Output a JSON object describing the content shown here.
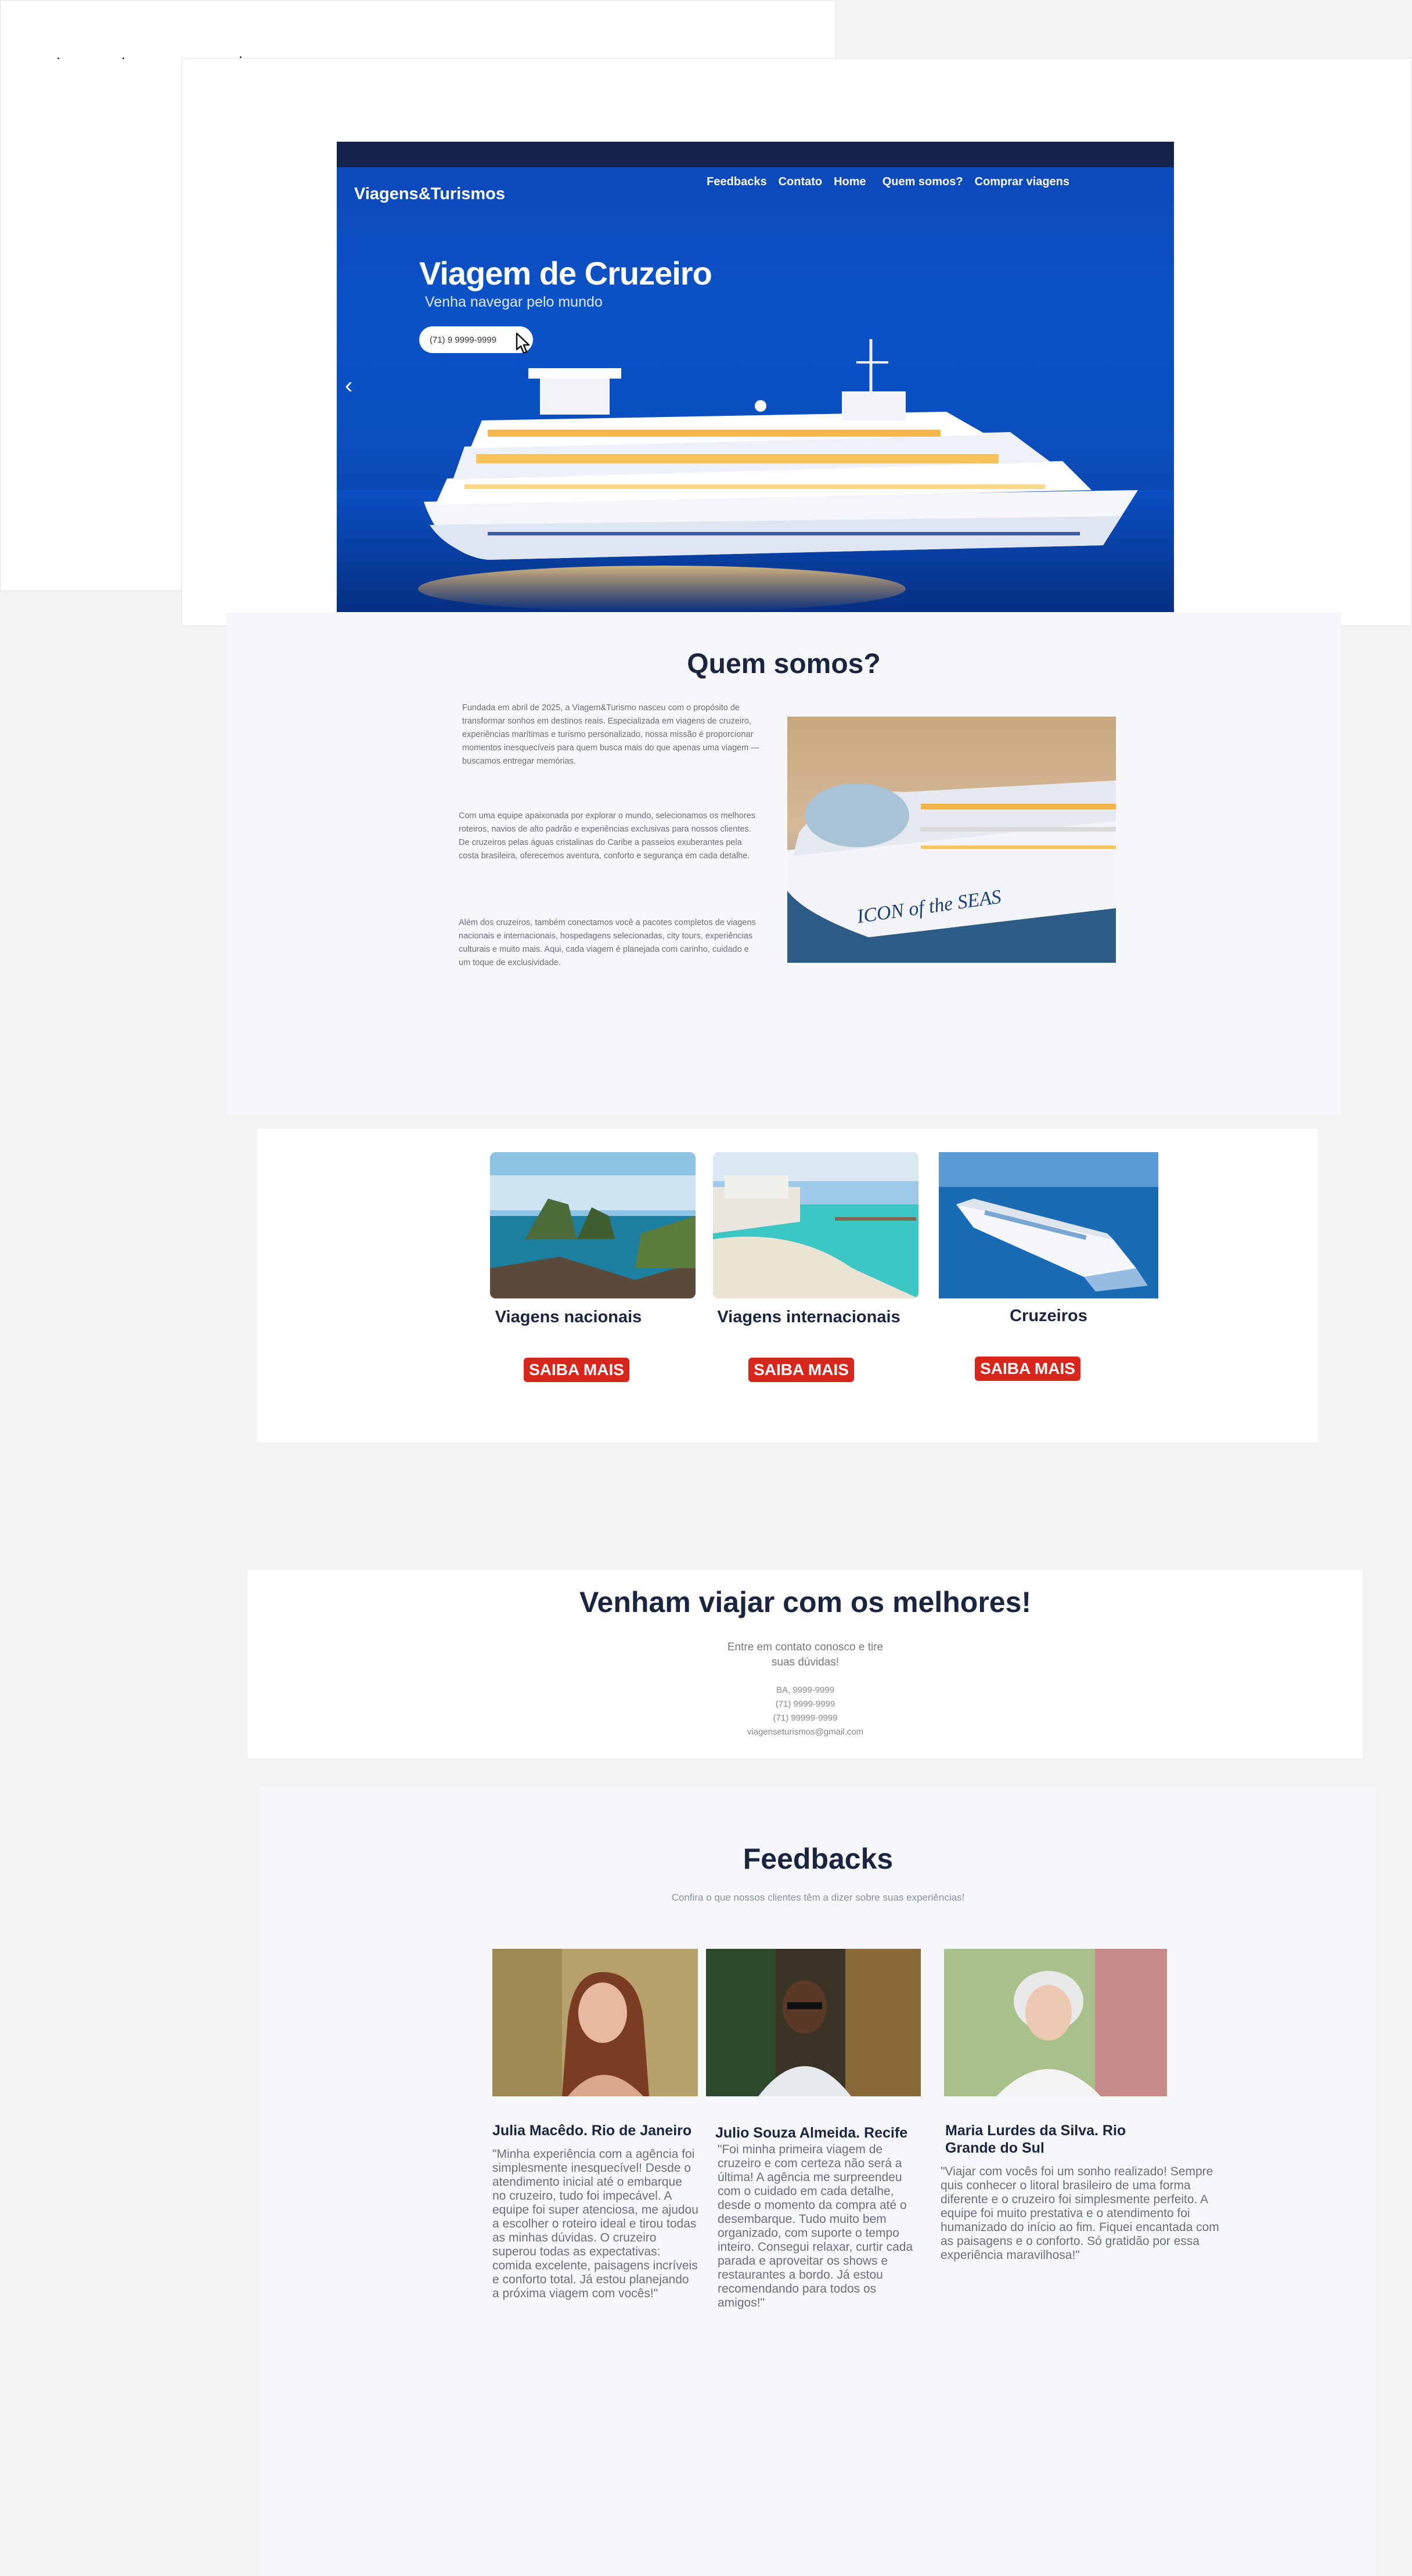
{
  "hero": {
    "brand": "Viagens&Turismos",
    "nav": [
      "Feedbacks",
      "Contato",
      "Home",
      "Quem somos?",
      "Comprar viagens"
    ],
    "title": "Viagem de Cruzeiro",
    "subtitle": "Venha navegar pelo mundo",
    "phone": "(71) 9 9999-9999",
    "prev_arrow": "‹"
  },
  "about": {
    "title": "Quem somos?",
    "paragraphs": [
      "Fundada em abril de 2025, a Viagem&Turismo nasceu com o propósito de transformar sonhos em destinos reais. Especializada em viagens de cruzeiro, experiências marítimas e turismo personalizado, nossa missão é proporcionar momentos inesquecíveis para quem busca mais do que apenas uma viagem — buscamos entregar memórias.",
      "Com uma equipe apaixonada por explorar o mundo, selecionamos os melhores roteiros, navios de alto padrão e experiências exclusivas para nossos clientes. De cruzeiros pelas águas cristalinas do Caribe a passeios exuberantes pela costa brasileira, oferecemos aventura, conforto e segurança em cada detalhe.",
      "Além dos cruzeiros, também conectamos você a pacotes completos de viagens nacionais e internacionais, hospedagens selecionadas, city tours, experiências culturais e muito mais. Aqui, cada viagem é planejada com carinho, cuidado e um toque de exclusividade."
    ],
    "ship_name": "ICON of the SEAS"
  },
  "cards": [
    {
      "title": "Viagens nacionais",
      "button": "SAIBA MAIS"
    },
    {
      "title": "Viagens internacionais",
      "button": "SAIBA MAIS"
    },
    {
      "title": "Cruzeiros",
      "button": "SAIBA MAIS"
    }
  ],
  "cta": {
    "title": "Venham viajar com os melhores!",
    "text_line1": "Entre em contato conosco e tire",
    "text_line2": "suas dúvidas!",
    "contacts": [
      "BA, 9999-9999",
      "(71) 9999-9999",
      "(71) 99999-9999",
      "viagenseturismos@gmail.com"
    ]
  },
  "feedbacks": {
    "title": "Feedbacks",
    "subtitle": "Confira o que nossos clientes têm a dizer sobre suas experiências!",
    "items": [
      {
        "name": "Julia Macêdo. Rio de Janeiro",
        "text": "\"Minha experiência com a agência foi simplesmente inesquecível! Desde o atendimento inicial até o embarque no cruzeiro, tudo foi impecável. A equipe foi super atenciosa, me ajudou a escolher o roteiro ideal e tirou todas as minhas dúvidas. O cruzeiro superou todas as expectativas: comida excelente, paisagens incríveis e conforto total. Já estou planejando a próxima viagem com vocês!\""
      },
      {
        "name": "Julio Souza Almeida. Recife",
        "text": "\"Foi minha primeira viagem de cruzeiro e com certeza não será a última! A agência me surpreendeu com o cuidado em cada detalhe, desde o momento da compra até o desembarque. Tudo muito bem organizado, com suporte o tempo inteiro. Consegui relaxar, curtir cada parada e aproveitar os shows e restaurantes a bordo. Já estou recomendando para todos os amigos!\""
      },
      {
        "name": "Maria Lurdes da Silva. Rio Grande do Sul",
        "text": "\"Viajar com vocês foi um sonho realizado! Sempre quis conhecer o litoral brasileiro de uma forma diferente e o cruzeiro foi simplesmente perfeito. A equipe foi muito prestativa e o atendimento foi humanizado do início ao fim. Fiquei encantada com as paisagens e o conforto. Só gratidão por essa experiência maravilhosa!\""
      }
    ]
  },
  "colors": {
    "navy": "#1b2540",
    "hero_blue": "#0b52c7",
    "button_red": "#d9261c"
  }
}
